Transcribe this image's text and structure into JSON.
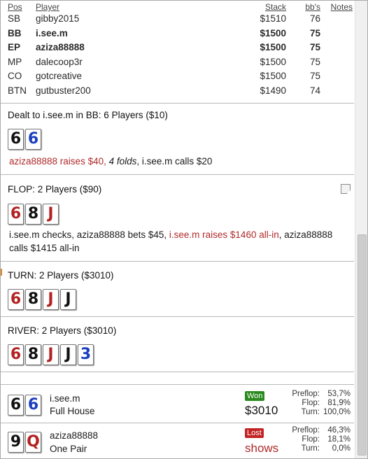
{
  "table": {
    "headers": {
      "pos": "Pos",
      "player": "Player",
      "stack": "Stack",
      "bbs": "bb's",
      "notes": "Notes"
    },
    "rows": [
      {
        "pos": "SB",
        "player": "gibby2015",
        "stack": "$1510",
        "bbs": "76",
        "bold": false
      },
      {
        "pos": "BB",
        "player": "i.see.m",
        "stack": "$1500",
        "bbs": "75",
        "bold": true
      },
      {
        "pos": "EP",
        "player": "aziza88888",
        "stack": "$1500",
        "bbs": "75",
        "bold": true
      },
      {
        "pos": "MP",
        "player": "dalecoop3r",
        "stack": "$1500",
        "bbs": "75",
        "bold": false
      },
      {
        "pos": "CO",
        "player": "gotcreative",
        "stack": "$1500",
        "bbs": "75",
        "bold": false
      },
      {
        "pos": "BTN",
        "player": "gutbuster200",
        "stack": "$1490",
        "bbs": "74",
        "bold": false
      }
    ]
  },
  "preflop": {
    "title": "Dealt to i.see.m in BB: 6 Players ($10)",
    "cards": [
      {
        "rank": "6",
        "suit": "spade"
      },
      {
        "rank": "6",
        "suit": "diamond"
      }
    ],
    "action": {
      "raise": "aziza88888 raises $40,",
      "folds": "4 folds",
      "rest": ", i.see.m calls $20"
    }
  },
  "flop": {
    "title": "FLOP: 2 Players ($90)",
    "cards": [
      {
        "rank": "6",
        "suit": "heart"
      },
      {
        "rank": "8",
        "suit": "spade"
      },
      {
        "rank": "J",
        "suit": "heart"
      }
    ],
    "action": {
      "part1": "i.see.m checks, aziza88888 bets $45, ",
      "raise": "i.see.m raises $1460 all-in",
      "part2": ", aziza88888 calls $1415 all-in"
    }
  },
  "turn": {
    "title": "TURN: 2 Players ($3010)",
    "cards": [
      {
        "rank": "6",
        "suit": "heart"
      },
      {
        "rank": "8",
        "suit": "spade"
      },
      {
        "rank": "J",
        "suit": "heart"
      },
      {
        "rank": "J",
        "suit": "spade"
      }
    ]
  },
  "river": {
    "title": "RIVER: 2 Players ($3010)",
    "cards": [
      {
        "rank": "6",
        "suit": "heart"
      },
      {
        "rank": "8",
        "suit": "spade"
      },
      {
        "rank": "J",
        "suit": "heart"
      },
      {
        "rank": "J",
        "suit": "spade"
      },
      {
        "rank": "3",
        "suit": "diamond"
      }
    ]
  },
  "results": [
    {
      "cards": [
        {
          "rank": "6",
          "suit": "spade"
        },
        {
          "rank": "6",
          "suit": "diamond"
        }
      ],
      "name": "i.see.m",
      "hand": "Full House",
      "badge": "Won",
      "badge_type": "won",
      "amount": "$3010",
      "stats": [
        {
          "label": "Preflop:",
          "value": "53,7%"
        },
        {
          "label": "Flop:",
          "value": "81,9%"
        },
        {
          "label": "Turn:",
          "value": "100,0%"
        }
      ]
    },
    {
      "cards": [
        {
          "rank": "9",
          "suit": "spade"
        },
        {
          "rank": "Q",
          "suit": "heart"
        }
      ],
      "name": "aziza88888",
      "hand": "One Pair",
      "badge": "Lost",
      "badge_type": "lost",
      "amount": "shows",
      "stats": [
        {
          "label": "Preflop:",
          "value": "46,3%"
        },
        {
          "label": "Flop:",
          "value": "18,1%"
        },
        {
          "label": "Turn:",
          "value": "0,0%"
        }
      ]
    }
  ]
}
